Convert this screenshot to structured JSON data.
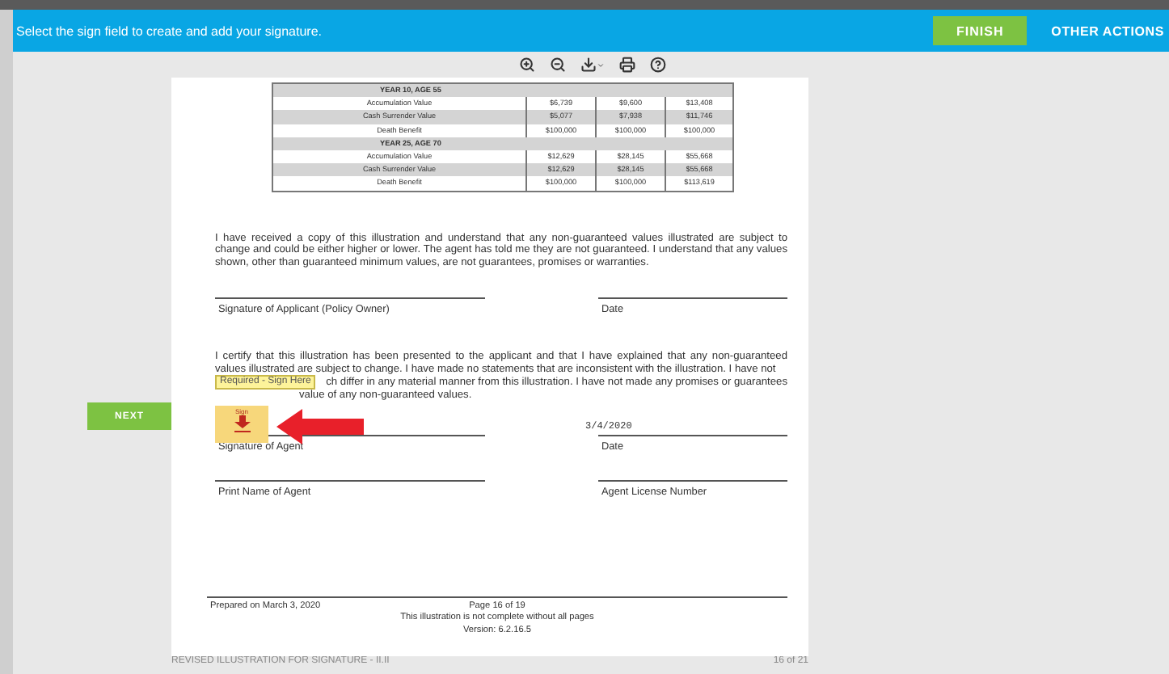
{
  "banner": {
    "message": "Select the sign field to create and add your signature.",
    "finish": "FINISH",
    "other_actions": "OTHER ACTIONS"
  },
  "side": {
    "next": "NEXT"
  },
  "table": {
    "rows": [
      {
        "kind": "heading",
        "shaded": true,
        "cells": [
          "YEAR 10, AGE 55"
        ]
      },
      {
        "kind": "value",
        "shaded": false,
        "cells": [
          "Accumulation Value",
          "$6,739",
          "$9,600",
          "$13,408"
        ]
      },
      {
        "kind": "value",
        "shaded": true,
        "cells": [
          "Cash Surrender Value",
          "$5,077",
          "$7,938",
          "$11,746"
        ]
      },
      {
        "kind": "value",
        "shaded": false,
        "cells": [
          "Death Benefit",
          "$100,000",
          "$100,000",
          "$100,000"
        ]
      },
      {
        "kind": "heading",
        "shaded": true,
        "cells": [
          "YEAR 25, AGE 70"
        ]
      },
      {
        "kind": "value",
        "shaded": false,
        "cells": [
          "Accumulation Value",
          "$12,629",
          "$28,145",
          "$55,668"
        ]
      },
      {
        "kind": "value",
        "shaded": true,
        "cells": [
          "Cash Surrender Value",
          "$12,629",
          "$28,145",
          "$55,668"
        ]
      },
      {
        "kind": "value",
        "shaded": false,
        "cells": [
          "Death Benefit",
          "$100,000",
          "$100,000",
          "$113,619"
        ]
      }
    ]
  },
  "applicant": {
    "statement": "I have received a copy of this illustration and understand that any non-guaranteed values illustrated are subject to change and could be either higher or lower. The agent has told me they are not guaranteed. I understand that any values shown, other than guaranteed minimum values, are not guarantees, promises or warranties.",
    "signature_label": "Signature of Applicant (Policy Owner)",
    "date_label": "Date"
  },
  "agent": {
    "statement": "I certify that this illustration has been presented to the applicant and that I have explained that any non-guaranteed values illustrated are subject to change. I have made no statements that are inconsistent with the illustration. I have not",
    "statement_line_3": "ch differ in any material manner from this illustration. I have not made any promises or guarantees",
    "statement_line_4": "value of any non-guaranteed values.",
    "tooltip": "Required - Sign Here",
    "sign_field": "Sign",
    "date_value": "3/4/2020",
    "signature_label": "Signature of Agent",
    "date_label": "Date",
    "name_label": "Print Name of Agent",
    "license_label": "Agent License Number"
  },
  "page_footer": {
    "prepared": "Prepared on March 3, 2020",
    "page": "Page 16 of 19",
    "note": "This illustration is not complete without all pages",
    "version": "Version: 6.2.16.5"
  },
  "document_footer": {
    "title": "REVISED ILLUSTRATION FOR SIGNATURE - II.II",
    "count": "16 of 21"
  }
}
